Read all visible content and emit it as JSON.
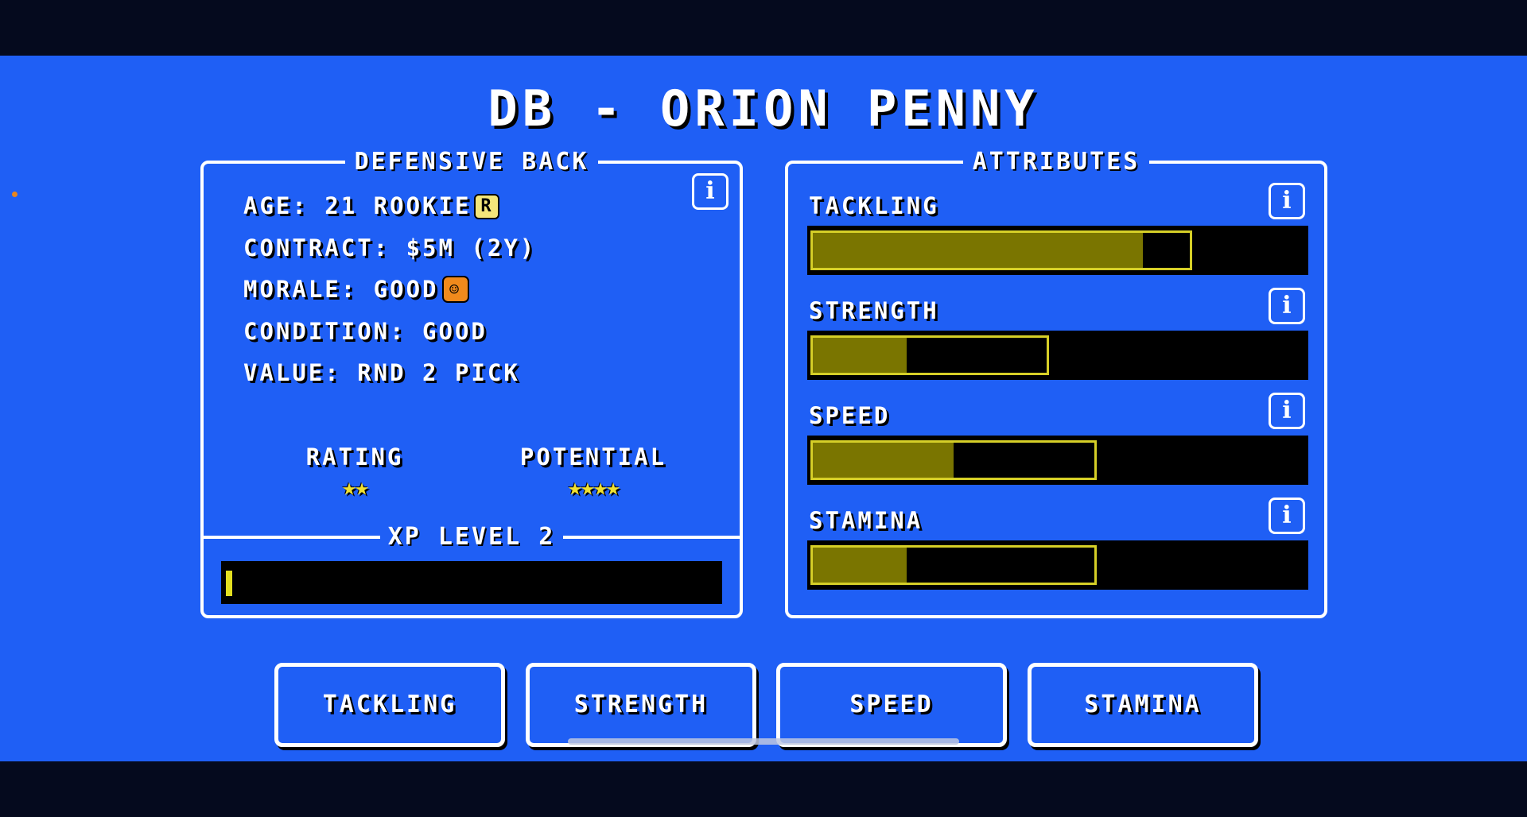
{
  "header": {
    "title": "DB - ORION PENNY"
  },
  "profile": {
    "legend": "DEFENSIVE BACK",
    "info_glyph": "i",
    "age_line": "AGE: 21 ROOKIE",
    "rookie_badge": "R",
    "contract_line": "CONTRACT: $5M (2Y)",
    "morale_line": "MORALE: GOOD",
    "morale_badge": "☺",
    "condition_line": "CONDITION: GOOD",
    "value_line": "VALUE: RND 2 PICK",
    "rating_label": "RATING",
    "rating_stars": 2,
    "rating_stars_text": "★★",
    "potential_label": "POTENTIAL",
    "potential_stars": 4,
    "potential_stars_text": "★★★★",
    "xp_legend": "XP LEVEL 2",
    "xp_progress_fraction": 0.01
  },
  "attributes": {
    "legend": "ATTRIBUTES",
    "info_glyph": "i",
    "items": [
      {
        "label": "TACKLING",
        "value_fraction": 0.7,
        "cap_fraction": 0.8
      },
      {
        "label": "STRENGTH",
        "value_fraction": 0.2,
        "cap_fraction": 0.5
      },
      {
        "label": "SPEED",
        "value_fraction": 0.3,
        "cap_fraction": 0.6
      },
      {
        "label": "STAMINA",
        "value_fraction": 0.2,
        "cap_fraction": 0.6
      }
    ]
  },
  "training": {
    "buttons": [
      "TACKLING",
      "STRENGTH",
      "SPEED",
      "STAMINA"
    ]
  },
  "colors": {
    "background": "#1f5ff5",
    "bar_fill": "#7a7500",
    "bar_cap": "#d6cf27",
    "xp_fill": "#e3df20",
    "star": "#f0e030"
  }
}
